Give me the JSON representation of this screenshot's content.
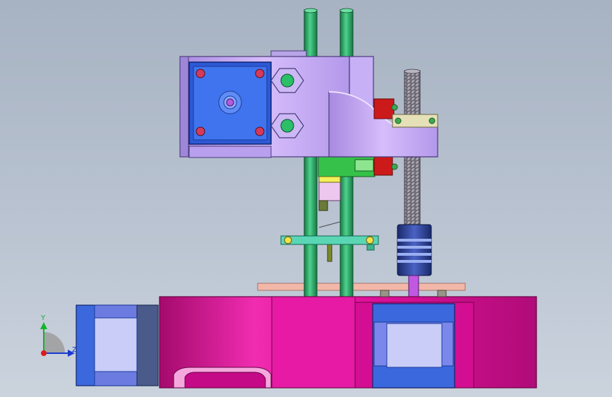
{
  "view": {
    "colors": {
      "background_top": "#a7b2c2",
      "background_bottom": "#cbd3dd",
      "base": "#e0109a",
      "carriage": "#c6a6f4",
      "motor_blue": "#3a6fe0",
      "rod_green": "#2fa66a",
      "coupler_blue": "#2c3f8c",
      "red_block": "#d81c1c"
    }
  },
  "triad": {
    "y_label": "Y",
    "z_label": "Z"
  }
}
